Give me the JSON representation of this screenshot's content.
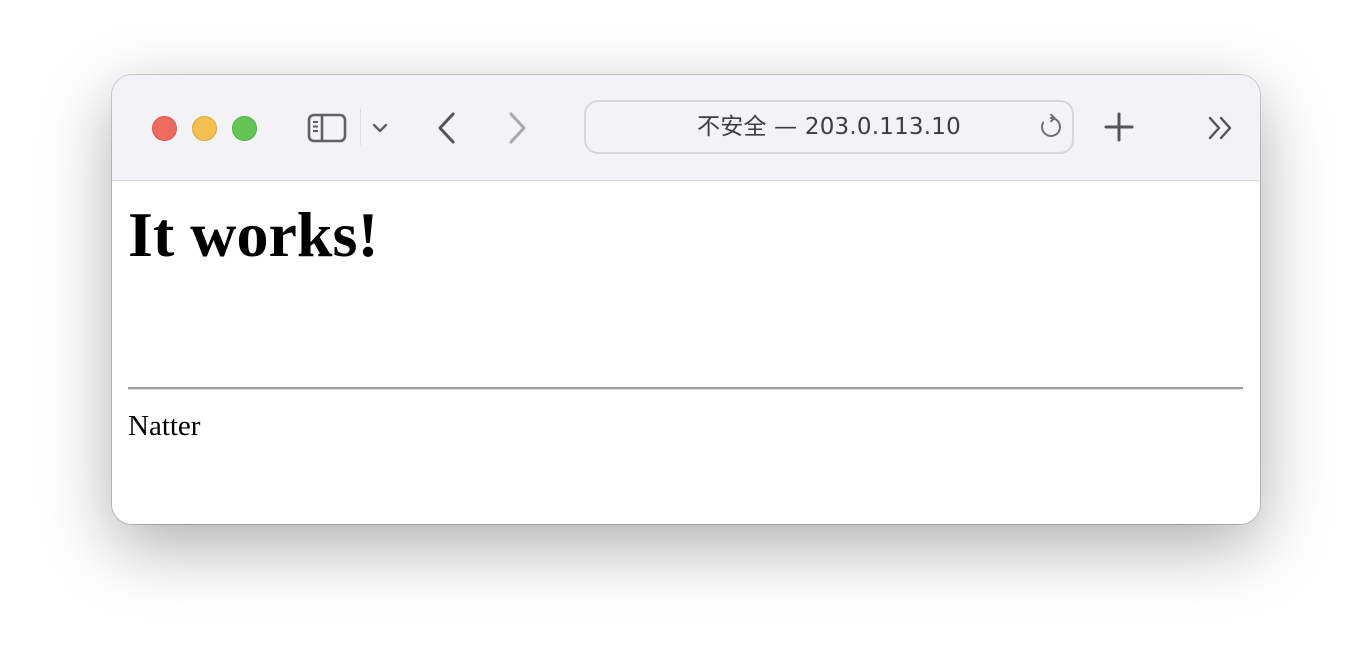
{
  "browser": {
    "address": "不安全 — 203.0.113.10",
    "icons": {
      "sidebar": "sidebar-icon",
      "sidebar_menu": "chevron-down-icon",
      "back": "chevron-left-icon",
      "forward": "chevron-right-icon",
      "reload": "reload-icon",
      "new_tab": "plus-icon",
      "overflow": "double-chevron-right-icon"
    },
    "colors": {
      "close": "#ed6a5e",
      "minimize": "#f5bf4f",
      "maximize": "#62c655",
      "toolbar_bg": "#f3f2f7"
    }
  },
  "page": {
    "heading": "It works!",
    "footer": "Natter"
  }
}
